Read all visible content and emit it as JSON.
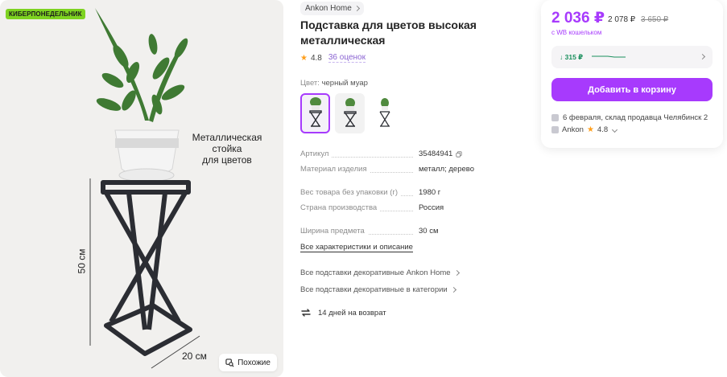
{
  "photo": {
    "promo_badge": "КИБЕРПОНЕДЕЛЬНИК",
    "caption_lines": [
      "Металлическая",
      "стойка",
      "для цветов"
    ],
    "height_label": "50 см",
    "width_label": "20 см",
    "similar_button": "Похожие"
  },
  "product": {
    "brand": "Ankon Home",
    "title": "Подставка для цветов высокая металлическая",
    "rating": "4.8",
    "reviews": "36 оценок",
    "color_label": "Цвет:",
    "color_value": "черный муар"
  },
  "specs": [
    {
      "label": "Артикул",
      "value": "35484941"
    },
    {
      "label": "Материал изделия",
      "value": "металл; дерево"
    },
    {
      "label": "Вес товара без упаковки (г)",
      "value": "1980 г"
    },
    {
      "label": "Страна производства",
      "value": "Россия"
    },
    {
      "label": "Ширина предмета",
      "value": "30 см"
    }
  ],
  "links": {
    "all_specs": "Все характеристики и описание",
    "brand_category": "Все подставки декоративные Ankon Home",
    "category": "Все подставки декоративные в категории",
    "returns": "14 дней на возврат"
  },
  "buy": {
    "price": "2 036 ₽",
    "price_no_wallet": "2 078 ₽",
    "price_old": "3 650 ₽",
    "wallet_note": "с WB кошельком",
    "price_drop": "↓ 315 ₽",
    "cart_button": "Добавить в корзину",
    "delivery": "6 февраля, склад продавца Челябинск 2",
    "seller": "Ankon",
    "seller_rating": "4.8"
  },
  "colors": {
    "accent": "#a73afd",
    "promo": "#7ed321",
    "star": "#ff9f1c",
    "drop": "#1a8f5d"
  }
}
